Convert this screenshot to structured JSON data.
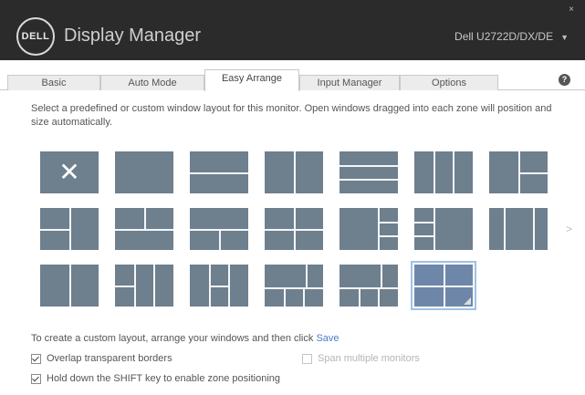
{
  "header": {
    "logo_text": "DELL",
    "app_title": "Display Manager",
    "monitor": "Dell U2722D/DX/DE",
    "close_symbol": "×"
  },
  "tabs": [
    {
      "label": "Basic",
      "active": false
    },
    {
      "label": "Auto Mode",
      "active": false
    },
    {
      "label": "Easy Arrange",
      "active": true
    },
    {
      "label": "Input Manager",
      "active": false
    },
    {
      "label": "Options",
      "active": false
    }
  ],
  "help_symbol": "?",
  "description": "Select a predefined or custom window layout for this monitor. Open windows dragged into each zone will position and size automatically.",
  "layouts": {
    "rows": 3,
    "columns": 7,
    "selected": 20,
    "first_tile_symbol": "✕",
    "next_page_icon": "chevron-right-icon",
    "next_page_symbol": ">"
  },
  "custom": {
    "text": "To create a custom layout, arrange your windows and then click",
    "link": "Save"
  },
  "options": {
    "overlap_label": "Overlap transparent borders",
    "overlap_checked": true,
    "span_label": "Span multiple monitors",
    "span_checked": false,
    "span_enabled": false,
    "shift_label": "Hold down the SHIFT key to enable zone positioning",
    "shift_checked": true
  }
}
